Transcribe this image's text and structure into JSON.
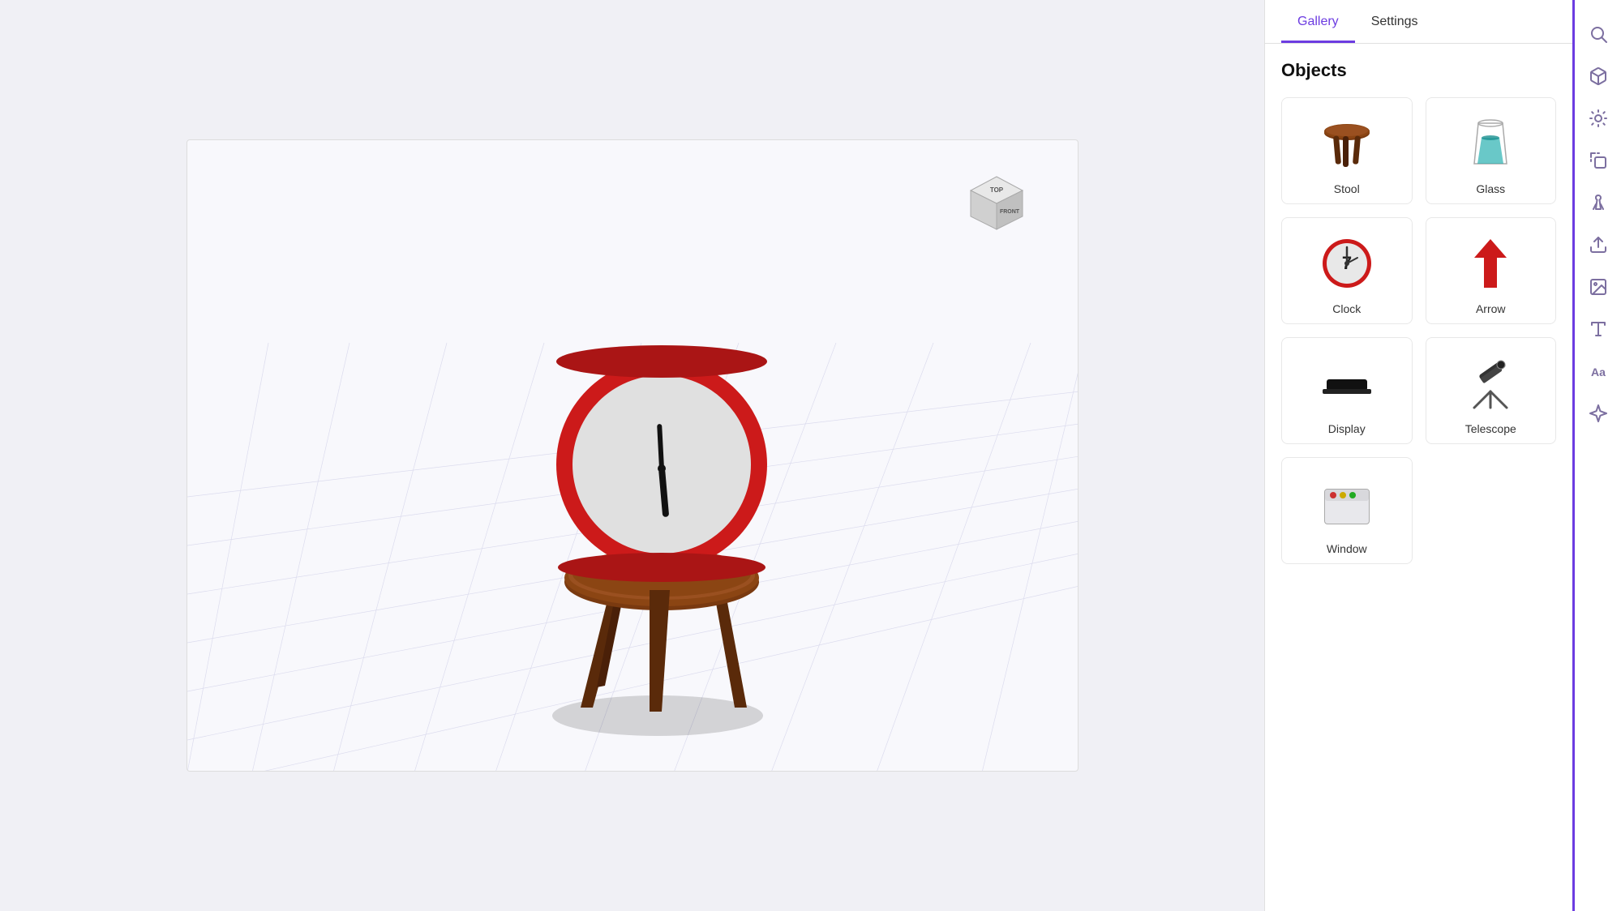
{
  "tabs": [
    {
      "label": "Gallery",
      "active": true
    },
    {
      "label": "Settings",
      "active": false
    }
  ],
  "panel": {
    "objects_title": "Objects"
  },
  "objects": [
    {
      "id": "stool",
      "label": "Stool"
    },
    {
      "id": "glass",
      "label": "Glass"
    },
    {
      "id": "clock",
      "label": "Clock"
    },
    {
      "id": "arrow",
      "label": "Arrow"
    },
    {
      "id": "display",
      "label": "Display"
    },
    {
      "id": "telescope",
      "label": "Telescope"
    },
    {
      "id": "window",
      "label": "Window"
    }
  ],
  "toolbar_icons": [
    {
      "name": "search-icon",
      "label": "Search"
    },
    {
      "name": "cube-icon",
      "label": "3D Object"
    },
    {
      "name": "light-icon",
      "label": "Lighting"
    },
    {
      "name": "transform-icon",
      "label": "Transform"
    },
    {
      "name": "models-icon",
      "label": "Models"
    },
    {
      "name": "upload-icon",
      "label": "Upload"
    },
    {
      "name": "image-icon",
      "label": "Image"
    },
    {
      "name": "text-icon",
      "label": "Text"
    },
    {
      "name": "font-icon",
      "label": "Font"
    },
    {
      "name": "sparkle-icon",
      "label": "AI"
    }
  ],
  "orient_cube": {
    "top_label": "TOP",
    "front_label": "FRONT"
  },
  "colors": {
    "accent": "#6c3ce1",
    "stool_dark": "#5a2a0a",
    "stool_mid": "#7a3a0f",
    "clock_red": "#cc1a1a",
    "clock_face": "#e8e8e8",
    "arrow_red": "#cc1a1a",
    "glass_teal": "#2ab0b0"
  }
}
